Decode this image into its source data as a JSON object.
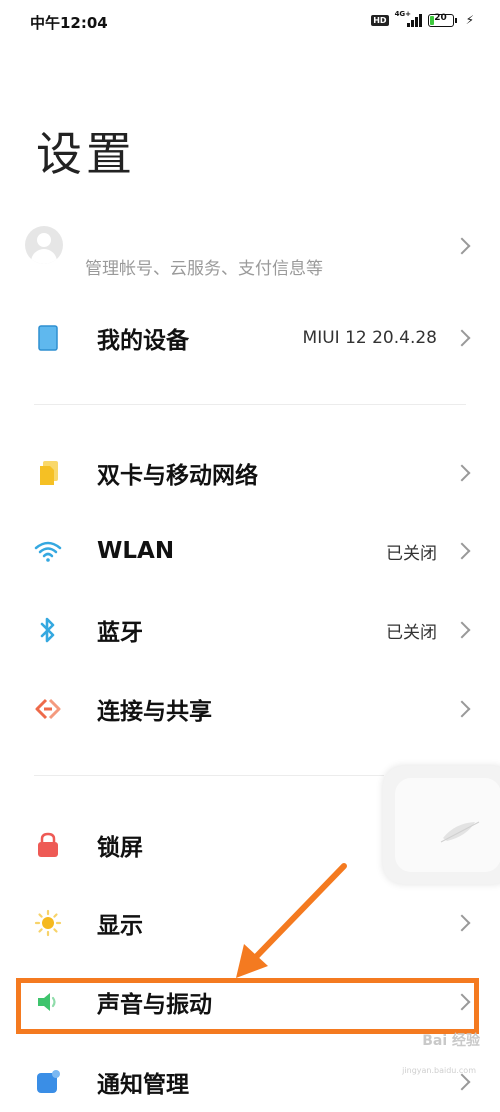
{
  "status_bar": {
    "time": "中午12:04",
    "hd": "HD",
    "network": "4G+",
    "battery": "20",
    "battery_level": 0.2
  },
  "header": {
    "title": "设置"
  },
  "account": {
    "subtitle": "管理帐号、云服务、支付信息等"
  },
  "rows": [
    {
      "label": "我的设备",
      "value": "MIUI 12 20.4.28",
      "icon": "tablet-icon",
      "color": "#4aa8e8"
    },
    {
      "label": "双卡与移动网络",
      "value": "",
      "icon": "sim-card-icon",
      "color": "#f6c531"
    },
    {
      "label": "WLAN",
      "value": "已关闭",
      "icon": "wifi-icon",
      "color": "#35a8e0"
    },
    {
      "label": "蓝牙",
      "value": "已关闭",
      "icon": "bluetooth-icon",
      "color": "#35a8e0"
    },
    {
      "label": "连接与共享",
      "value": "",
      "icon": "share-icon",
      "color": "#ee6a4a"
    },
    {
      "label": "锁屏",
      "value": "",
      "icon": "lock-icon",
      "color": "#ee5a55"
    },
    {
      "label": "显示",
      "value": "",
      "icon": "sun-icon",
      "color": "#f5b91f"
    },
    {
      "label": "声音与振动",
      "value": "",
      "icon": "speaker-icon",
      "color": "#3ec46d"
    },
    {
      "label": "通知管理",
      "value": "",
      "icon": "notification-icon",
      "color": "#3a8ee6"
    }
  ],
  "watermark": {
    "text": "Bai 经验",
    "sub": "jingyan.baidu.com"
  },
  "annotation": {
    "color": "#f47a20"
  }
}
